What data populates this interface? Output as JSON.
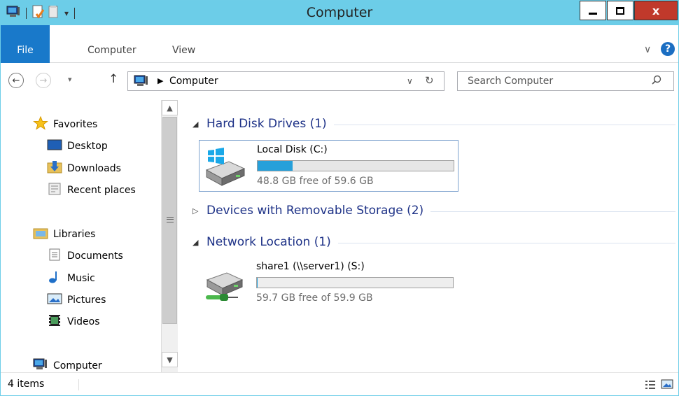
{
  "window": {
    "title": "Computer"
  },
  "title_buttons": {
    "close": "x"
  },
  "ribbon": {
    "tabs": [
      {
        "label": "File"
      },
      {
        "label": "Computer"
      },
      {
        "label": "View"
      }
    ],
    "help": "?"
  },
  "address": {
    "crumbs": [
      "Computer"
    ],
    "search_placeholder": "Search Computer"
  },
  "nav": {
    "favorites": {
      "label": "Favorites",
      "items": [
        {
          "label": "Desktop"
        },
        {
          "label": "Downloads"
        },
        {
          "label": "Recent places"
        }
      ]
    },
    "libraries": {
      "label": "Libraries",
      "items": [
        {
          "label": "Documents"
        },
        {
          "label": "Music"
        },
        {
          "label": "Pictures"
        },
        {
          "label": "Videos"
        }
      ]
    },
    "computer": {
      "label": "Computer"
    }
  },
  "content": {
    "groups": [
      {
        "title": "Hard Disk Drives (1)",
        "expanded": true,
        "items": [
          {
            "name": "Local Disk (C:)",
            "free": "48.8 GB free of 59.6 GB",
            "used_fraction": 0.18,
            "icon": "windows-drive-icon"
          }
        ]
      },
      {
        "title": "Devices with Removable Storage (2)",
        "expanded": false,
        "items": []
      },
      {
        "title": "Network Location (1)",
        "expanded": true,
        "items": [
          {
            "name": "share1 (\\\\server1) (S:)",
            "free": "59.7 GB free of 59.9 GB",
            "used_fraction": 0.003,
            "icon": "network-drive-icon"
          }
        ]
      }
    ]
  },
  "status": {
    "items_count": "4 items"
  },
  "colors": {
    "titlebar": "#6ccde8",
    "file_tab": "#1979ca",
    "progress": "#26a0da",
    "group_title": "#1e3287"
  }
}
